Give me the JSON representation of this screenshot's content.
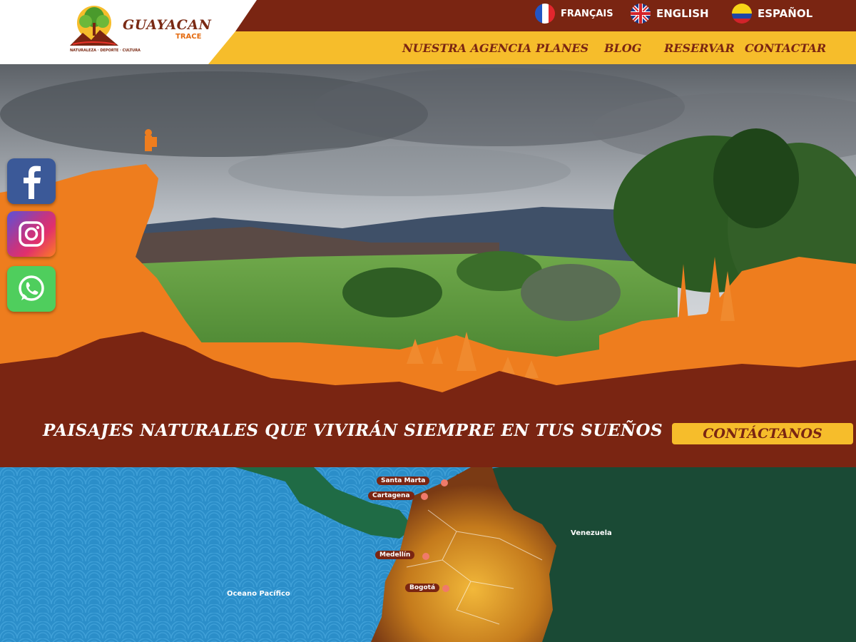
{
  "brand": {
    "name": "GUAYACAN",
    "sub": "TRACE",
    "tagline": "NATURALEZA · DEPORTE · CULTURA"
  },
  "languages": [
    {
      "label": "FRANÇAIS",
      "icon": "france-flag-icon"
    },
    {
      "label": "ENGLISH",
      "icon": "uk-flag-icon"
    },
    {
      "label": "ESPAÑOL",
      "icon": "colombia-flag-icon"
    }
  ],
  "nav": [
    {
      "label": "NUESTRA AGENCIA"
    },
    {
      "label": "PLANES"
    },
    {
      "label": "BLOG"
    },
    {
      "label": "RESERVAR"
    },
    {
      "label": "CONTACTAR"
    }
  ],
  "social": [
    {
      "icon": "facebook-icon"
    },
    {
      "icon": "instagram-icon"
    },
    {
      "icon": "whatsapp-icon"
    }
  ],
  "hero": {
    "tagline": "PAISAJES NATURALES QUE VIVIRÁN SIEMPRE EN TUS SUEÑOS",
    "cta_label": "CONTÁCTANOS"
  },
  "map": {
    "cities": [
      {
        "label": "Santa Marta"
      },
      {
        "label": "Cartagena"
      },
      {
        "label": "Medellín"
      },
      {
        "label": "Bogotá"
      }
    ],
    "labels": {
      "venezuela": "Venezuela",
      "ocean": "Oceano Pacífico"
    }
  },
  "colors": {
    "brown": "#7a2512",
    "yellow": "#f6bd2b",
    "orange": "#ee7d1e",
    "ocean": "#2b8ec9"
  }
}
